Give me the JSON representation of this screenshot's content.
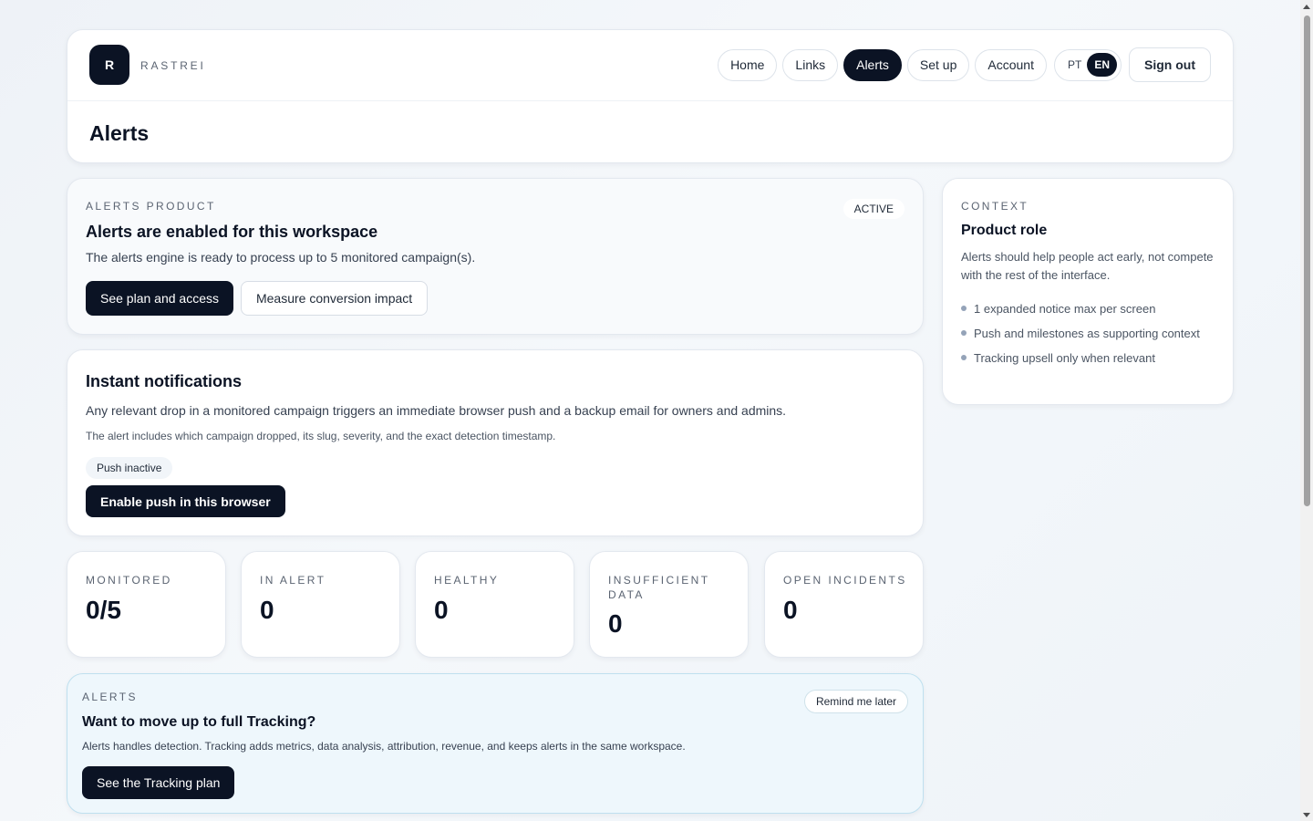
{
  "header": {
    "logo_letter": "R",
    "brand": "RASTREI",
    "nav": [
      "Home",
      "Links",
      "Alerts",
      "Set up",
      "Account"
    ],
    "active_nav": "Alerts",
    "lang": {
      "pt": "PT",
      "en": "EN",
      "active": "EN"
    },
    "signout": "Sign out",
    "page_title": "Alerts"
  },
  "product": {
    "eyebrow": "ALERTS PRODUCT",
    "badge": "ACTIVE",
    "title": "Alerts are enabled for this workspace",
    "text": "The alerts engine is ready to process up to 5 monitored campaign(s).",
    "primary_btn": "See plan and access",
    "secondary_btn": "Measure conversion impact"
  },
  "notify": {
    "title": "Instant notifications",
    "text": "Any relevant drop in a monitored campaign triggers an immediate browser push and a backup email for owners and admins.",
    "detail": "The alert includes which campaign dropped, its slug, severity, and the exact detection timestamp.",
    "chip": "Push inactive",
    "btn": "Enable push in this browser"
  },
  "stats": [
    {
      "label": "MONITORED",
      "value": "0/5"
    },
    {
      "label": "IN ALERT",
      "value": "0"
    },
    {
      "label": "HEALTHY",
      "value": "0"
    },
    {
      "label": "INSUFFICIENT DATA",
      "value": "0"
    },
    {
      "label": "OPEN INCIDENTS",
      "value": "0"
    }
  ],
  "upsell": {
    "eyebrow": "ALERTS",
    "remind": "Remind me later",
    "title": "Want to move up to full Tracking?",
    "text": "Alerts handles detection. Tracking adds metrics, data analysis, attribution, revenue, and keeps alerts in the same workspace.",
    "btn": "See the Tracking plan"
  },
  "context": {
    "eyebrow": "CONTEXT",
    "title": "Product role",
    "desc": "Alerts should help people act early, not compete with the rest of the interface.",
    "items": [
      "1 expanded notice max per screen",
      "Push and milestones as supporting context",
      "Tracking upsell only when relevant"
    ]
  }
}
